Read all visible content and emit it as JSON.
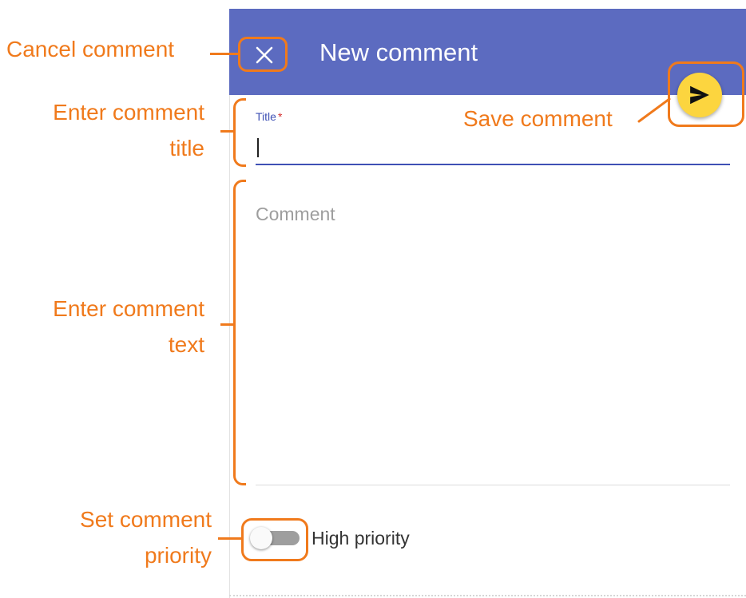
{
  "dialog": {
    "title": "New comment",
    "close_icon": "close-icon",
    "save_icon": "send-icon"
  },
  "form": {
    "title_label": "Title",
    "title_required_marker": "*",
    "title_value": "",
    "comment_placeholder": "Comment",
    "comment_value": "",
    "priority_label": "High priority",
    "priority_on": false
  },
  "annotations": {
    "cancel": "Cancel comment",
    "title_line1": "Enter comment",
    "title_line2": "title",
    "save": "Save comment",
    "text_line1": "Enter comment",
    "text_line2": "text",
    "priority_line1": "Set comment",
    "priority_line2": "priority"
  },
  "colors": {
    "header": "#5c6bc0",
    "accent": "#3f51b5",
    "fab": "#fcd53f",
    "annotation": "#f07a1c"
  }
}
